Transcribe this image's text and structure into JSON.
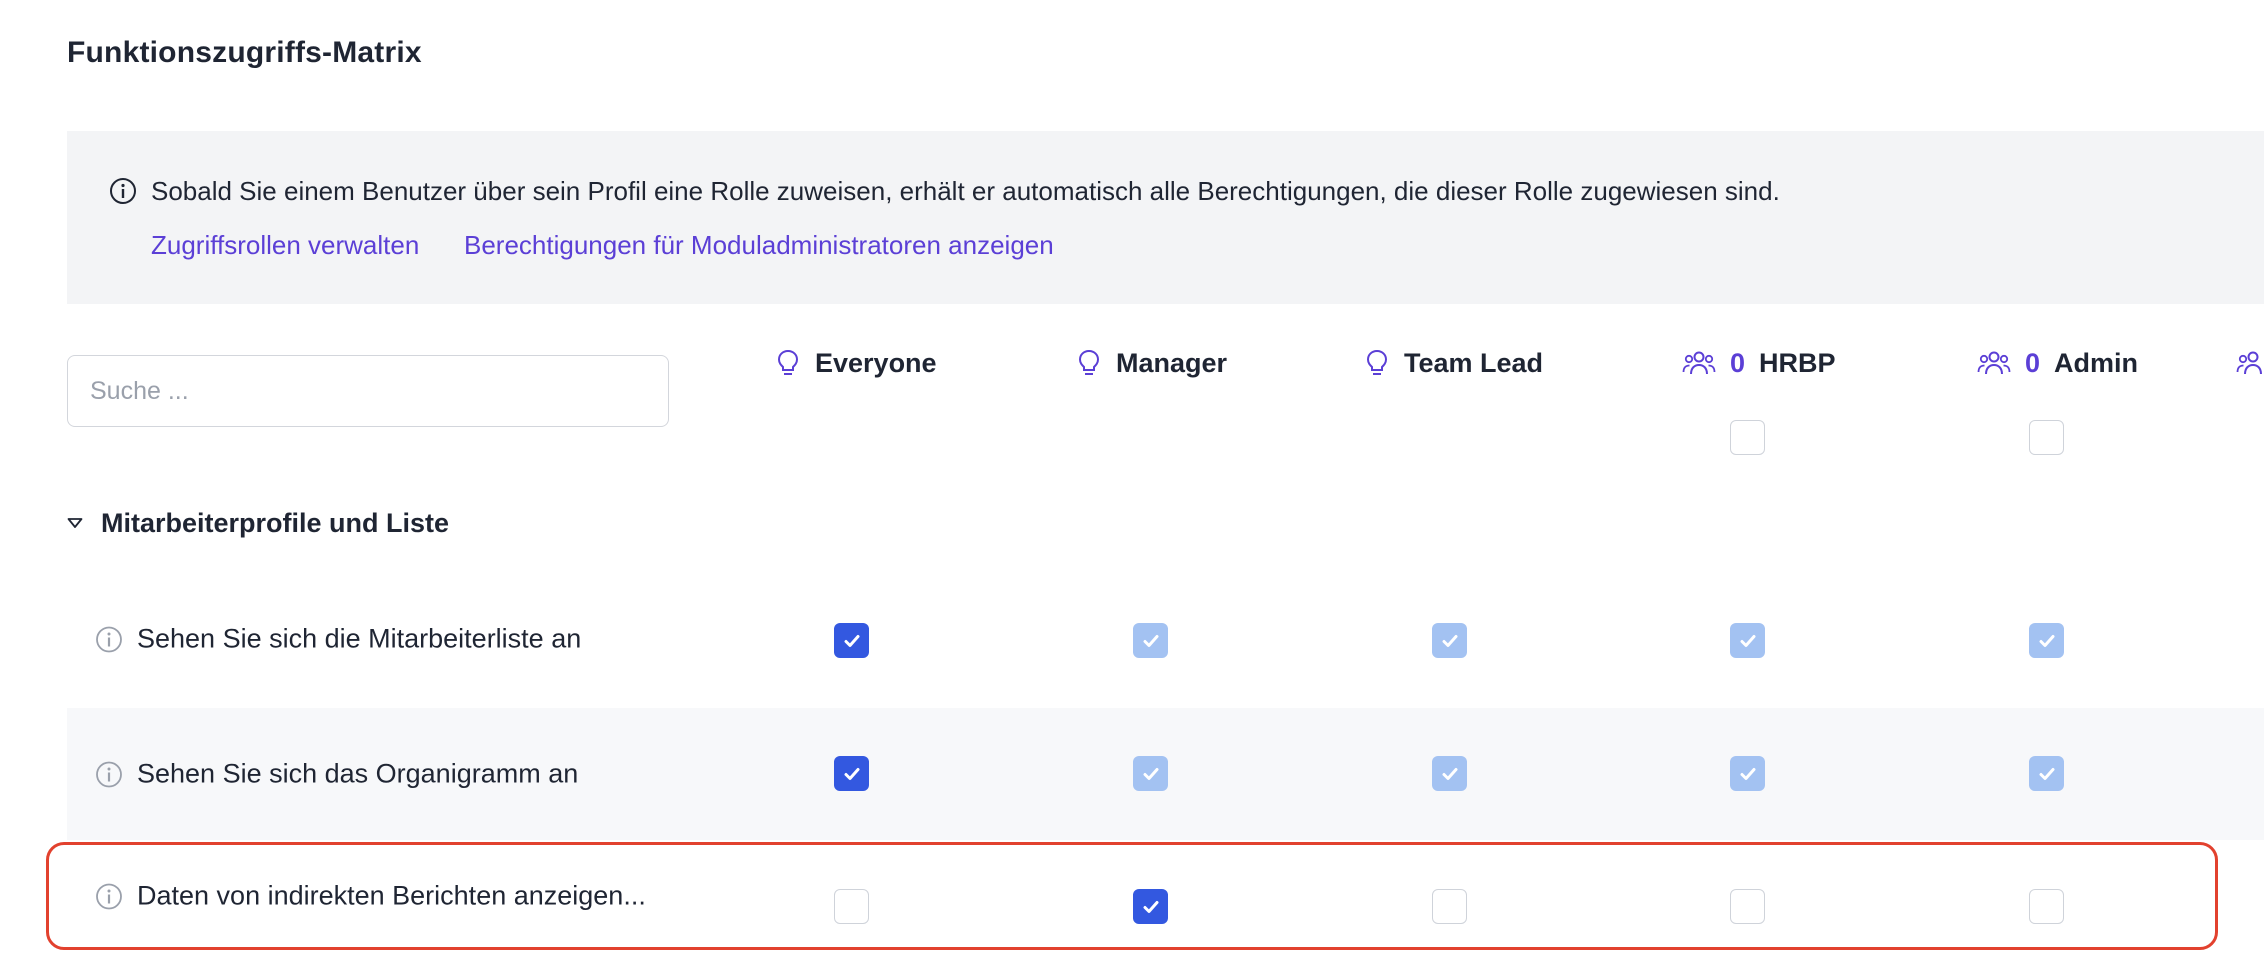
{
  "page": {
    "title": "Funktionszugriffs-Matrix"
  },
  "banner": {
    "text": "Sobald Sie einem Benutzer über sein Profil eine Rolle zuweisen, erhält er automatisch alle Berechtigungen, die dieser Rolle zugewiesen sind.",
    "links": [
      "Zugriffsrollen verwalten",
      "Berechtigungen für Moduladministratoren anzeigen"
    ]
  },
  "search": {
    "placeholder": "Suche ..."
  },
  "columns": [
    {
      "label": "Everyone",
      "icon": "lightbulb-icon",
      "count": null
    },
    {
      "label": "Manager",
      "icon": "lightbulb-icon",
      "count": null
    },
    {
      "label": "Team Lead",
      "icon": "lightbulb-icon",
      "count": null
    },
    {
      "label": "HRBP",
      "icon": "people-group-icon",
      "count": "0"
    },
    {
      "label": "Admin",
      "icon": "people-group-icon",
      "count": "0"
    }
  ],
  "section": {
    "label": "Mitarbeiterprofile und Liste",
    "expanded": true
  },
  "rows": [
    {
      "label": "Sehen Sie sich die Mitarbeiterliste an",
      "states": [
        "checked",
        "inherited",
        "inherited",
        "inherited",
        "inherited"
      ]
    },
    {
      "label": "Sehen Sie sich das Organigramm an",
      "states": [
        "checked",
        "inherited",
        "inherited",
        "inherited",
        "inherited"
      ]
    },
    {
      "label": "Daten von indirekten Berichten anzeigen...",
      "states": [
        "empty",
        "checked",
        "empty",
        "empty",
        "empty"
      ]
    }
  ],
  "colors": {
    "accent": "#5b3fd6",
    "checked": "#3358e0",
    "inherited": "#a3c2f2",
    "highlight": "#e2412e"
  }
}
